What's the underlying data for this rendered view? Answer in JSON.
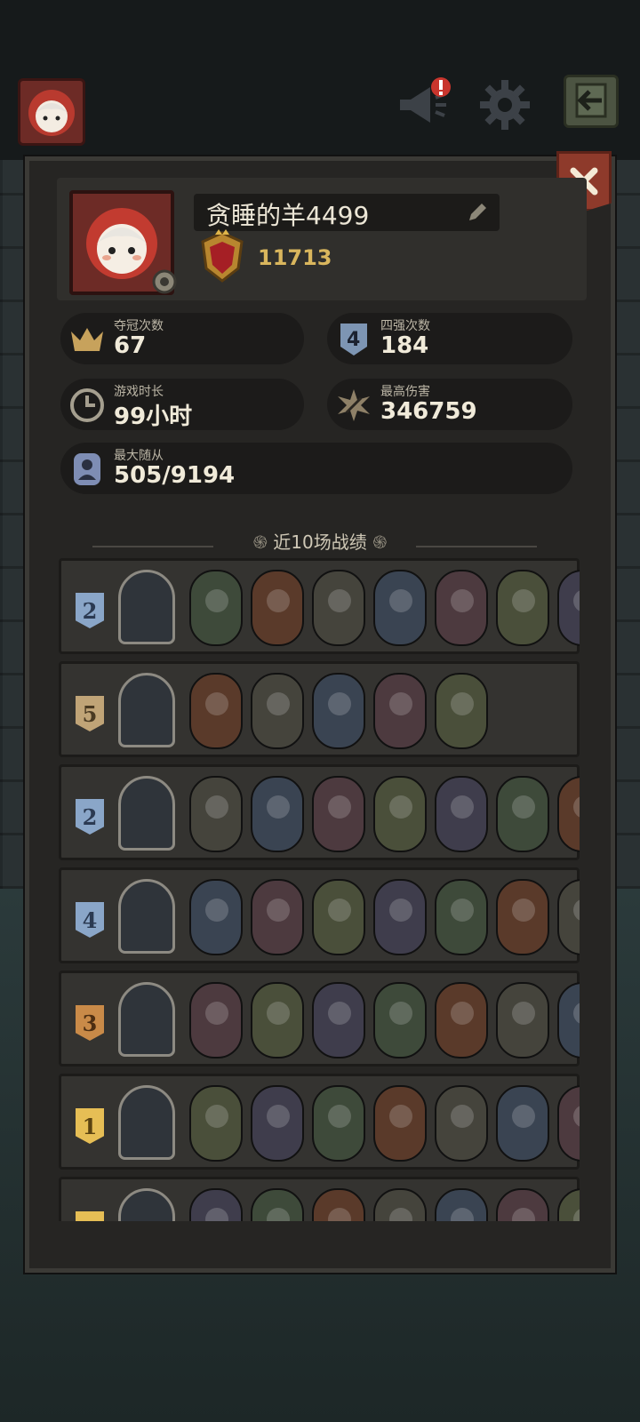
{
  "colors": {
    "accent_gold": "#d9b65d",
    "panel_bg": "#262523",
    "close_red": "#8e3a2b",
    "place_blue": "#7895b6",
    "place_tan": "#b79a6c",
    "place_bronze": "#b97a3c",
    "place_gold": "#e0b64a"
  },
  "topbar": {
    "avatar_icon": "player-avatar-icon",
    "announce_icon": "megaphone-icon",
    "settings_icon": "gear-icon",
    "exit_icon": "exit-arrow-icon"
  },
  "profile": {
    "name": "贪睡的羊4499",
    "rank_score": "11713",
    "rank_icon": "crown-shield-icon",
    "edit_icon": "pencil-icon",
    "avatar_settings_icon": "gear-icon"
  },
  "stats": [
    {
      "label": "夺冠次数",
      "value": "67",
      "icon": "crown-icon"
    },
    {
      "label": "四强次数",
      "value": "184",
      "icon": "top4-shield-icon"
    },
    {
      "label": "游戏时长",
      "value": "99小时",
      "icon": "clock-icon"
    },
    {
      "label": "最高伤害",
      "value": "346759",
      "icon": "burst-sword-icon"
    },
    {
      "label": "最大随从",
      "value": "505/9194",
      "icon": "minion-portrait-icon"
    }
  ],
  "history": {
    "title": "近10场战绩",
    "matches": [
      {
        "place": "2",
        "tone": "blue",
        "units": 7
      },
      {
        "place": "5",
        "tone": "tan",
        "units": 5
      },
      {
        "place": "2",
        "tone": "blue",
        "units": 7
      },
      {
        "place": "4",
        "tone": "blue",
        "units": 7
      },
      {
        "place": "3",
        "tone": "bronze",
        "units": 7
      },
      {
        "place": "1",
        "tone": "gold",
        "units": 7
      },
      {
        "place": "",
        "tone": "gold",
        "units": 7
      }
    ]
  }
}
